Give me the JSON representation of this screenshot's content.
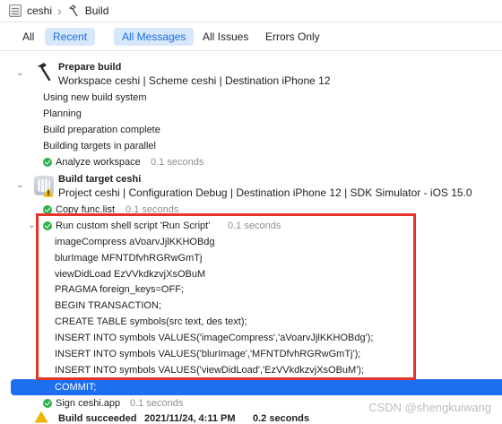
{
  "breadcrumb": {
    "project": "ceshi",
    "item": "Build"
  },
  "filters": {
    "all": "All",
    "recent": "Recent",
    "all_messages": "All Messages",
    "all_issues": "All Issues",
    "errors_only": "Errors Only"
  },
  "log": {
    "prepare": {
      "title": "Prepare build",
      "subtitle": "Workspace ceshi | Scheme ceshi | Destination iPhone 12",
      "lines": [
        "Using new build system",
        "Planning",
        "Build preparation complete",
        "Building targets in parallel"
      ],
      "analyze": "Analyze workspace",
      "analyze_time": "0.1 seconds"
    },
    "target": {
      "title": "Build target ceshi",
      "subtitle": "Project ceshi | Configuration Debug | Destination iPhone 12 | SDK Simulator - iOS 15.0",
      "copy": "Copy func.list",
      "copy_time": "0.1 seconds",
      "script": "Run custom shell script 'Run Script'",
      "script_time": "0.1 seconds",
      "output": [
        "imageCompress aVoarvJjlKKHOBdg",
        "blurImage MFNTDfvhRGRwGmTj",
        "viewDidLoad EzVVkdkzvjXsOBuM",
        "PRAGMA foreign_keys=OFF;",
        "BEGIN TRANSACTION;",
        "CREATE TABLE symbols(src text, des text);",
        "INSERT INTO symbols VALUES('imageCompress','aVoarvJjlKKHOBdg');",
        "INSERT INTO symbols VALUES('blurImage','MFNTDfvhRGRwGmTj');",
        "INSERT INTO symbols VALUES('viewDidLoad','EzVVkdkzvjXsOBuM');",
        "COMMIT;"
      ],
      "sign": "Sign ceshi.app",
      "sign_time": "0.1 seconds"
    },
    "result": {
      "status": "Build succeeded",
      "date": "2021/11/24, 4:11 PM",
      "duration": "0.2 seconds"
    }
  },
  "watermark": "CSDN @shengkuiwang",
  "colors": {
    "accent": "#1c6ff0",
    "success": "#2fb04a",
    "highlight_box": "#e6332a",
    "warning": "#f0b400"
  }
}
